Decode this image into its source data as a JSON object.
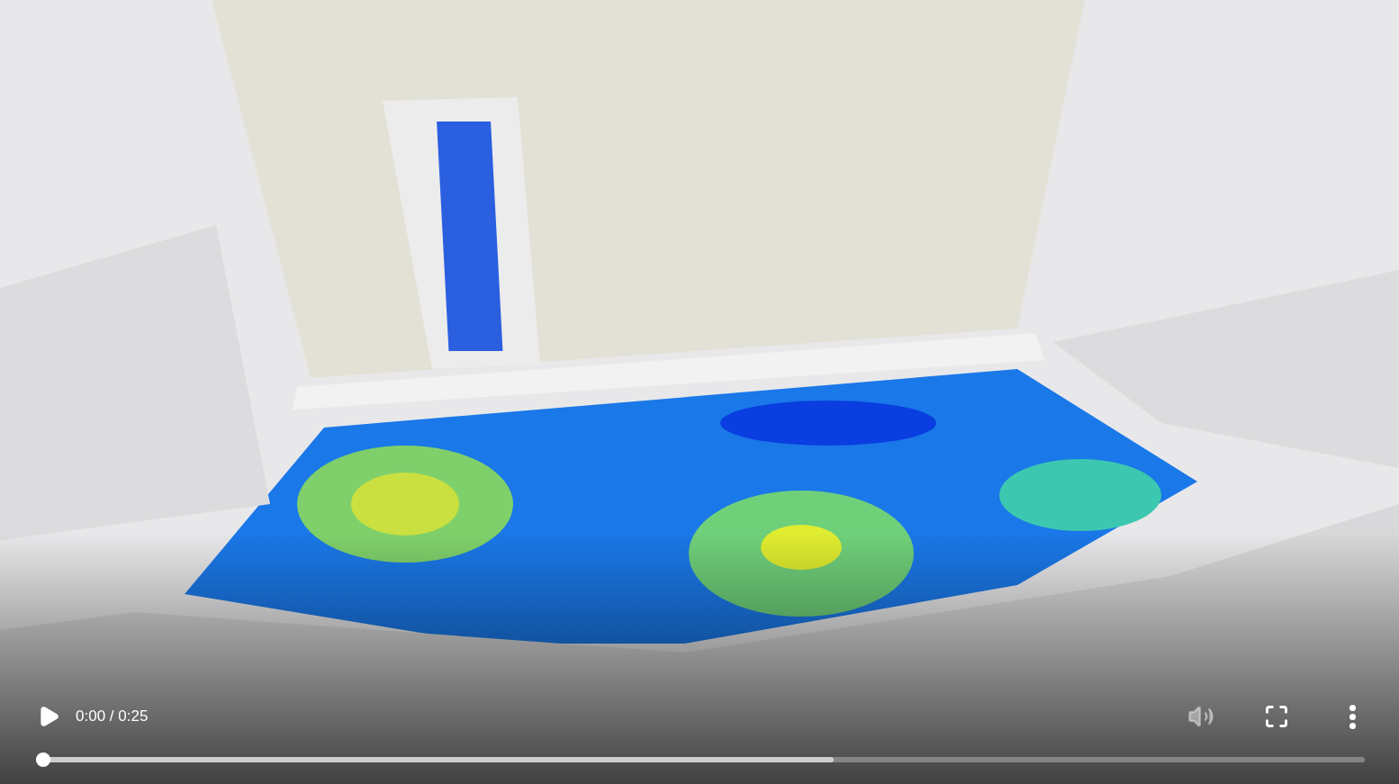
{
  "controls": {
    "playing": false,
    "time": "0:00 / 0:25",
    "volume": {
      "disabled": true
    },
    "progress": {
      "level": 0
    },
    "buffer": {
      "level": 0.6
    }
  }
}
